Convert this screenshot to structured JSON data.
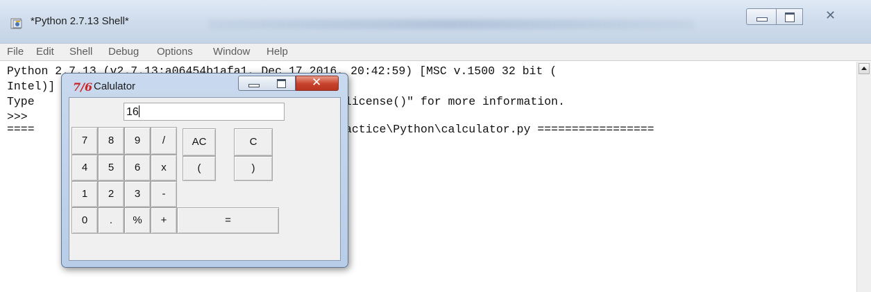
{
  "shell": {
    "title": "*Python 2.7.13 Shell*",
    "menu": [
      "File",
      "Edit",
      "Shell",
      "Debug",
      "Options",
      "Window",
      "Help"
    ],
    "lines": [
      "Python 2.7.13 (v2.7.13:a06454b1afa1, Dec 17 2016, 20:42:59) [MSC v.1500 32 bit (",
      "Intel)] on win32",
      "Type ",
      ">>> ",
      "==== "
    ],
    "line3_tail": "license()\" for more information.",
    "line5_tail": "actice\\Python\\calculator.py =================",
    "close_glyph": "✕"
  },
  "calculator": {
    "title": "Calulator",
    "icon": "7/6",
    "display_value": "16",
    "close_glyph": "✕",
    "keys": {
      "k7": "7",
      "k8": "8",
      "k9": "9",
      "div": "/",
      "ac": "AC",
      "c": "C",
      "k4": "4",
      "k5": "5",
      "k6": "6",
      "mul": "x",
      "lparen": "(",
      "rparen": ")",
      "k1": "1",
      "k2": "2",
      "k3": "3",
      "sub": "-",
      "k0": "0",
      "dot": ".",
      "mod": "%",
      "add": "+",
      "eq": "="
    }
  }
}
